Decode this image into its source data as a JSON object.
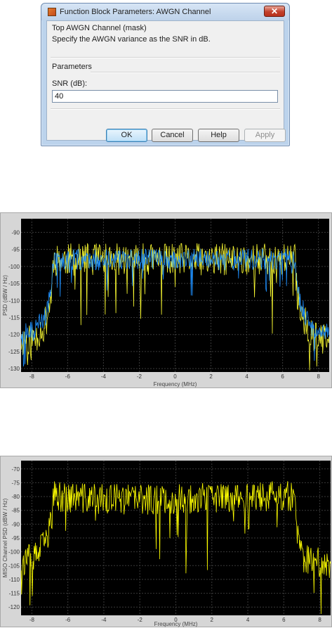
{
  "dialog": {
    "title": "Function Block Parameters: AWGN Channel",
    "close_glyph": "✕",
    "mask_title": "Top AWGN Channel (mask)",
    "description": "Specify the AWGN variance as the SNR in dB.",
    "params_header": "Parameters",
    "snr_label": "SNR (dB):",
    "snr_value": "40",
    "buttons": {
      "ok": "OK",
      "cancel": "Cancel",
      "help": "Help",
      "apply": "Apply"
    },
    "icons": {
      "app": "simulink-block-icon",
      "close": "close-icon"
    }
  },
  "chart_data": [
    {
      "type": "line",
      "ylabel": "PSD (dBW / Hz)",
      "xlabel": "Frequency (MHz)",
      "xlim": [
        -8.6,
        8.6
      ],
      "ylim": [
        -131,
        -86
      ],
      "xticks": [
        -8,
        -6,
        -4,
        -2,
        0,
        2,
        4,
        6,
        8
      ],
      "yticks": [
        -90,
        -95,
        -100,
        -105,
        -110,
        -115,
        -120,
        -125,
        -130
      ],
      "grid": true,
      "background": "#000000",
      "series": [
        {
          "color": "#ffff33",
          "x": [
            -8.6,
            -7.8,
            -7.2,
            -6.9,
            -6.8,
            -4.0,
            0.0,
            4.0,
            6.7,
            6.8,
            7.2,
            7.8,
            8.6
          ],
          "y": [
            -122,
            -121,
            -116,
            -108,
            -98,
            -98,
            -98,
            -98,
            -98,
            -108,
            -116,
            -121,
            -122
          ]
        },
        {
          "color": "#1e90ff",
          "x": [
            -8.6,
            -7.8,
            -7.2,
            -6.9,
            -6.8,
            -4.0,
            0.0,
            4.0,
            6.7,
            6.8,
            7.2,
            7.8,
            8.6
          ],
          "y": [
            -120,
            -119,
            -114,
            -106,
            -98,
            -98,
            -98,
            -98,
            -98,
            -106,
            -114,
            -119,
            -120
          ]
        }
      ]
    },
    {
      "type": "line",
      "ylabel": "MISO Channel PSD (dBW / Hz)",
      "xlabel": "Frequency (MHz)",
      "xlim": [
        -8.6,
        8.6
      ],
      "ylim": [
        -123,
        -67
      ],
      "xticks": [
        -8,
        -6,
        -4,
        -2,
        0,
        2,
        4,
        6,
        8
      ],
      "yticks": [
        -70,
        -75,
        -80,
        -85,
        -90,
        -95,
        -100,
        -105,
        -110,
        -115,
        -120
      ],
      "grid": true,
      "background": "#000000",
      "series": [
        {
          "color": "#ffff00",
          "x": [
            -8.6,
            -7.8,
            -7.2,
            -6.9,
            -6.8,
            -4.0,
            0.0,
            4.0,
            6.6,
            6.7,
            7.0,
            7.6,
            8.6
          ],
          "y": [
            -104,
            -102,
            -96,
            -88,
            -80,
            -81,
            -81,
            -80,
            -80,
            -92,
            -102,
            -104,
            -104
          ]
        }
      ]
    }
  ]
}
